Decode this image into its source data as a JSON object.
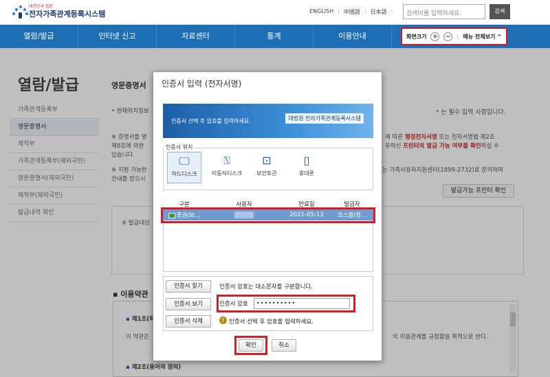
{
  "header": {
    "logo_small": "대한민국 법원",
    "logo_title": "전자가족관계등록시스템",
    "languages": [
      "ENGLISH",
      "中國語",
      "日本語"
    ],
    "search_placeholder": "검색어를 입력하세요.",
    "search_button": "검색"
  },
  "nav": {
    "items": [
      "열람/발급",
      "인터넷 신고",
      "자료센터",
      "통계",
      "이용안내"
    ],
    "zoom_label": "화면크기",
    "zoom_in": "+",
    "zoom_out": "−",
    "all_menu": "메뉴 전체보기 ^"
  },
  "sidebar": {
    "title": "열람/발급",
    "items": [
      {
        "label": "가족관계등록부",
        "active": false
      },
      {
        "label": "영문증명서",
        "active": true
      },
      {
        "label": "제적부",
        "active": false
      },
      {
        "label": "가족관계등록부(재외국민)",
        "active": false
      },
      {
        "label": "영문증명서(재외국민)",
        "active": false
      },
      {
        "label": "제적부(재외국민)",
        "active": false
      },
      {
        "label": "발급내역 확인",
        "active": false
      }
    ]
  },
  "main": {
    "subtitle": "영문증명서",
    "location_note": "• 현재위치정보",
    "required_note": "* 는 필수 입력 사항입니다.",
    "notice1_a": "※ 증명서를 열",
    "notice1_b": "제8조에 의한",
    "notice1_c": "있습니다.",
    "notice1_right_a": "에 따른 ",
    "notice1_right_red1": "행정전자서명",
    "notice1_right_b": " 또는 전자서명법 제2조",
    "notice1_right_c": "유하신 ",
    "notice1_right_red2": "프린터의 발급 가능 여부를 확인",
    "notice1_right_d": "하실 수",
    "notice2_a": "※ 지원 가능한",
    "notice2_b": "안내를 받으시",
    "notice2_right": "는 가족사용자지원센터(1899-2732)로 문의하여",
    "printer_button": "발급가능 프린터 확인",
    "issue_note": "※ 발급대상",
    "terms_heading": "이용약관",
    "terms_article1": "제1조",
    "terms_article1_suffix": "(목",
    "terms_line": "이 약관은",
    "terms_line_right": "의 이용관계를 규정함을 목적으로 한다.",
    "terms_article2": "제2조",
    "terms_article2_suffix": "(용어의 정의)"
  },
  "dialog": {
    "title": "인증서 입력 (전자서명)",
    "banner_text": "인증서 선택 후 암호를 입력하세요.",
    "banner_logo": "대법원 전자가족관계등록시스템",
    "location_legend": "인증서 위치",
    "locations": [
      {
        "label": "하드디스크",
        "icon": "monitor-icon",
        "selected": true
      },
      {
        "label": "이동식디스크",
        "icon": "usb-icon",
        "selected": false
      },
      {
        "label": "보안토큰",
        "icon": "token-icon",
        "selected": false
      },
      {
        "label": "휴대폰",
        "icon": "phone-icon",
        "selected": false
      }
    ],
    "columns": [
      "구분",
      "사용자",
      "만료일",
      "발급자"
    ],
    "certificate": {
      "type": "증권/보...",
      "user": "",
      "expiry": "2021-05-13",
      "issuer": "코스콤(증..."
    },
    "find_button": "인증서 찾기",
    "find_note": "인증서 암호는 대소문자를 구분합니다.",
    "view_button": "인증서 보기",
    "password_label": "인증서 암호",
    "password_value": "••••••••••",
    "delete_button": "인증서 삭제",
    "warning_text": "인증서 선택 후 암호를 입력하세요.",
    "ok_button": "확인",
    "cancel_button": "취소"
  },
  "colors": {
    "brand_blue": "#1e6fb6",
    "highlight_red": "#d21f26",
    "selected_row": "#6f9bd1"
  }
}
